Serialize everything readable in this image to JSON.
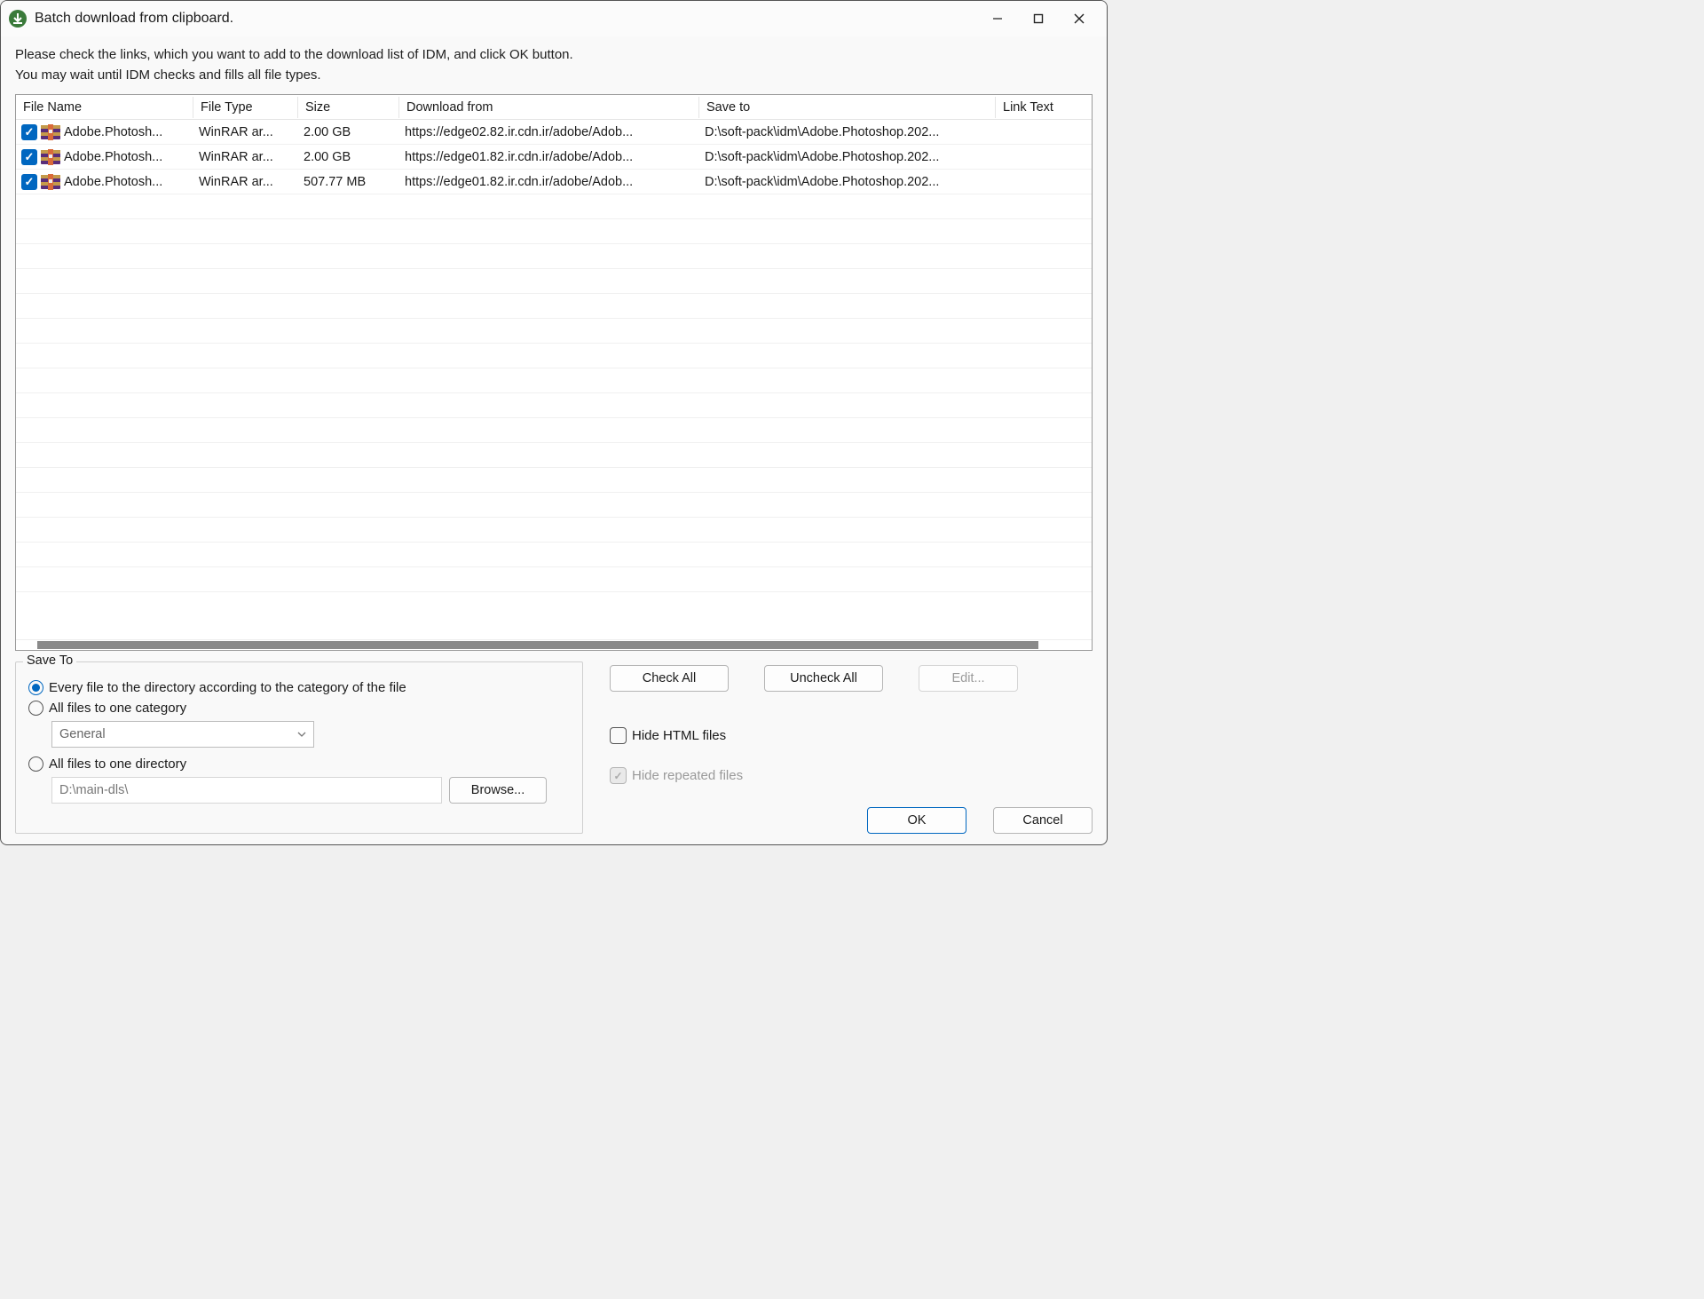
{
  "window": {
    "title": "Batch download from clipboard."
  },
  "instructions": {
    "line1": "Please check the links, which you want to add to the download list of IDM, and click OK button.",
    "line2": "You may wait until IDM checks and fills all file types."
  },
  "columns": {
    "name": "File Name",
    "type": "File Type",
    "size": "Size",
    "from": "Download from",
    "save": "Save to",
    "link": "Link Text"
  },
  "rows": [
    {
      "checked": true,
      "name": "Adobe.Photosh...",
      "type": "WinRAR ar...",
      "size": "2.00  GB",
      "from": "https://edge02.82.ir.cdn.ir/adobe/Adob...",
      "save": "D:\\soft-pack\\idm\\Adobe.Photoshop.202...",
      "link": ""
    },
    {
      "checked": true,
      "name": "Adobe.Photosh...",
      "type": "WinRAR ar...",
      "size": "2.00  GB",
      "from": "https://edge01.82.ir.cdn.ir/adobe/Adob...",
      "save": "D:\\soft-pack\\idm\\Adobe.Photoshop.202...",
      "link": ""
    },
    {
      "checked": true,
      "name": "Adobe.Photosh...",
      "type": "WinRAR ar...",
      "size": "507.77  MB",
      "from": "https://edge01.82.ir.cdn.ir/adobe/Adob...",
      "save": "D:\\soft-pack\\idm\\Adobe.Photoshop.202...",
      "link": ""
    }
  ],
  "saveTo": {
    "legend": "Save To",
    "opt1": "Every file to the directory according to the category of the file",
    "opt2": "All files to one category",
    "opt3": "All files to one directory",
    "categorySelected": "General",
    "directoryPath": "D:\\main-dls\\",
    "browse": "Browse..."
  },
  "buttons": {
    "checkAll": "Check All",
    "uncheckAll": "Uncheck All",
    "edit": "Edit...",
    "ok": "OK",
    "cancel": "Cancel"
  },
  "options": {
    "hideHtml": "Hide HTML files",
    "hideRepeated": "Hide repeated files"
  }
}
